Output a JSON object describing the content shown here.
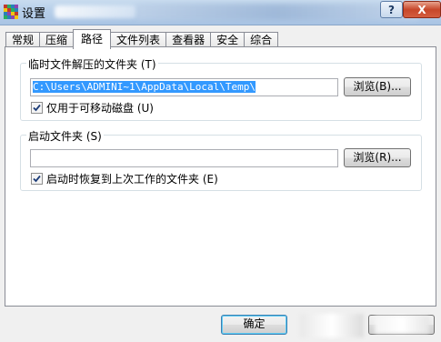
{
  "window": {
    "title": "设置",
    "help_label": "?",
    "close_label": "X"
  },
  "tabs": [
    {
      "label": "常规"
    },
    {
      "label": "压缩"
    },
    {
      "label": "路径",
      "active": true
    },
    {
      "label": "文件列表"
    },
    {
      "label": "查看器"
    },
    {
      "label": "安全"
    },
    {
      "label": "综合"
    }
  ],
  "temp_group": {
    "legend": "临时文件解压的文件夹 (T)",
    "path_value": "C:\\Users\\ADMINI~1\\AppData\\Local\\Temp\\",
    "browse_label": "浏览(B)...",
    "checkbox_label": "仅用于可移动磁盘 (U)",
    "checkbox_checked": true
  },
  "startup_group": {
    "legend": "启动文件夹 (S)",
    "path_value": "",
    "browse_label": "浏览(R)...",
    "checkbox_label": "启动时恢复到上次工作的文件夹 (E)",
    "checkbox_checked": true
  },
  "footer": {
    "ok_label": "确定"
  },
  "colors": {
    "selection": "#3399ff",
    "panel_bg": "#ffffff",
    "dialog_bg": "#f0f0f0"
  }
}
